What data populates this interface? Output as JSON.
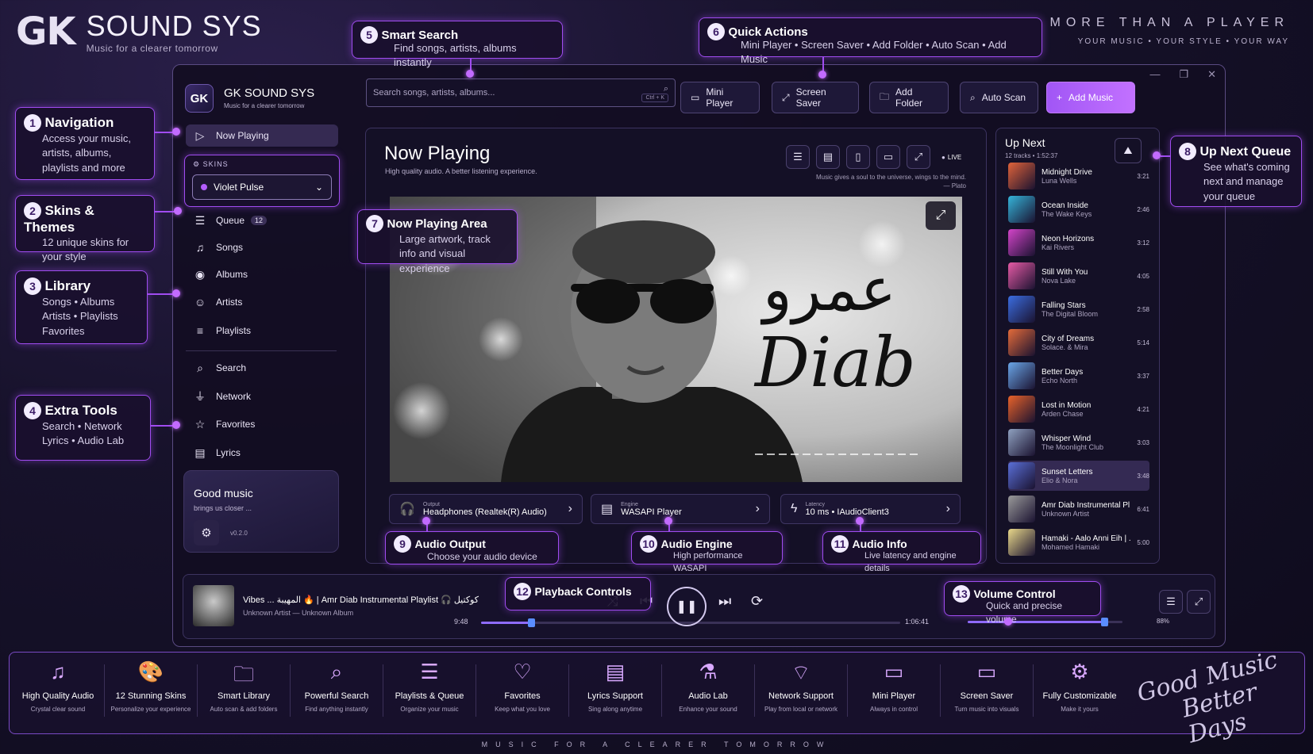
{
  "brand": {
    "logo": "GK",
    "name": "SOUND SYS",
    "tagline": "Music for a clearer tomorrow"
  },
  "header_right": {
    "title": "MORE THAN A PLAYER",
    "subtitle": "YOUR MUSIC  •  YOUR STYLE  •  YOUR WAY"
  },
  "window_controls": {
    "minimize": "—",
    "maximize": "❐",
    "close": "✕"
  },
  "callouts": [
    {
      "n": "1",
      "title": "Navigation",
      "sub": "Access your music, artists, albums, playlists and more"
    },
    {
      "n": "2",
      "title": "Skins & Themes",
      "sub": "12 unique skins for your style"
    },
    {
      "n": "3",
      "title": "Library",
      "sub": "Songs • Albums Artists • Playlists Favorites"
    },
    {
      "n": "4",
      "title": "Extra Tools",
      "sub": "Search • Network Lyrics • Audio Lab"
    },
    {
      "n": "5",
      "title": "Smart Search",
      "sub": "Find songs, artists, albums instantly"
    },
    {
      "n": "6",
      "title": "Quick Actions",
      "sub": "Mini Player • Screen Saver • Add Folder • Auto Scan • Add Music"
    },
    {
      "n": "7",
      "title": "Now Playing Area",
      "sub": "Large artwork, track info and visual experience"
    },
    {
      "n": "8",
      "title": "Up Next Queue",
      "sub": "See what's coming next and manage your queue"
    },
    {
      "n": "9",
      "title": "Audio Output",
      "sub": "Choose your audio device"
    },
    {
      "n": "10",
      "title": "Audio Engine",
      "sub": "High performance WASAPI"
    },
    {
      "n": "11",
      "title": "Audio Info",
      "sub": "Live latency and engine details"
    },
    {
      "n": "12",
      "title": "Playback Controls",
      "sub": ""
    },
    {
      "n": "13",
      "title": "Volume Control",
      "sub": "Quick and precise volume"
    }
  ],
  "sidebar": {
    "logo": "GK",
    "name": "GK SOUND SYS",
    "tagline": "Music for a clearer tomorrow",
    "now_playing": "Now Playing",
    "skins_label": "SKINS",
    "skin_selected": "Violet Pulse",
    "items": [
      {
        "label": "Queue",
        "badge": "12",
        "icon": "☰"
      },
      {
        "label": "Songs",
        "icon": "♫"
      },
      {
        "label": "Albums",
        "icon": "◉"
      },
      {
        "label": "Artists",
        "icon": "☺"
      },
      {
        "label": "Playlists",
        "icon": "≡"
      },
      {
        "label": "Search",
        "icon": "⌕"
      },
      {
        "label": "Network",
        "icon": "⏚"
      },
      {
        "label": "Favorites",
        "icon": "☆"
      },
      {
        "label": "Lyrics",
        "icon": "▤"
      }
    ],
    "card_title": "Good music",
    "card_sub": "brings us closer ...",
    "version": "v0.2.0"
  },
  "toolbar": {
    "search_placeholder": "Search songs, artists, albums...",
    "search_shortcut": "Ctrl + K",
    "mini_player": "Mini Player",
    "screen_saver": "Screen Saver",
    "add_folder": "Add Folder",
    "auto_scan": "Auto Scan",
    "add_music": "Add Music"
  },
  "now_playing": {
    "title": "Now Playing",
    "subtitle": "High quality audio. A better listening experience.",
    "quote": "Music gives a soul to the universe, wings to the mind.",
    "quote_author": "— Plato",
    "live": "LIVE",
    "art_text_arabic": "عمرو",
    "art_text_latin": "Diab"
  },
  "audio_info": {
    "output_label": "Output",
    "output_value": "Headphones (Realtek(R) Audio)",
    "engine_label": "Engine",
    "engine_value": "WASAPI Player",
    "latency_label": "Latency",
    "latency_value": "10 ms • IAudioClient3"
  },
  "up_next": {
    "title": "Up Next",
    "sub": "12 tracks • 1:52:37",
    "tracks": [
      {
        "song": "Midnight Drive",
        "artist": "Luna Wells",
        "dur": "3:21",
        "color": "#e0633a"
      },
      {
        "song": "Ocean Inside",
        "artist": "The Wake Keys",
        "dur": "2:46",
        "color": "#35b4d9"
      },
      {
        "song": "Neon Horizons",
        "artist": "Kai Rivers",
        "dur": "3:12",
        "color": "#d344c9"
      },
      {
        "song": "Still With You",
        "artist": "Nova Lake",
        "dur": "4:05",
        "color": "#e65aa5"
      },
      {
        "song": "Falling Stars",
        "artist": "The Digital Bloom",
        "dur": "2:58",
        "color": "#3b6de0"
      },
      {
        "song": "City of Dreams",
        "artist": "Solace. & Mira",
        "dur": "5:14",
        "color": "#e46b3a"
      },
      {
        "song": "Better Days",
        "artist": "Echo North",
        "dur": "3:37",
        "color": "#6aa6e8"
      },
      {
        "song": "Lost in Motion",
        "artist": "Arden Chase",
        "dur": "4:21",
        "color": "#e8622a"
      },
      {
        "song": "Whisper Wind",
        "artist": "The Moonlight Club",
        "dur": "3:03",
        "color": "#8fa1c0"
      },
      {
        "song": "Sunset Letters",
        "artist": "Elio & Nora",
        "dur": "3:48",
        "color": "#5a6fd8"
      },
      {
        "song": "Amr Diab Instrumental Pl... ♫",
        "artist": "Unknown Artist",
        "dur": "6:41",
        "color": "#9a9a9a"
      },
      {
        "song": "Hamaki - Aalo Anni Eih | ...",
        "artist": "Mohamed Hamaki",
        "dur": "5:00",
        "color": "#e9d88a"
      }
    ]
  },
  "player": {
    "track": "Vibes ... المهيبة 🔥 | Amr Diab Instrumental Playlist 🎧 كوكتيل",
    "artist": "Unknown Artist — Unknown Album",
    "elapsed": "9:48",
    "total": "1:06:41",
    "progress": 0.12,
    "volume": 0.88,
    "volume_label": "88%"
  },
  "features": [
    {
      "icon": "♫",
      "title": "High Quality Audio",
      "sub": "Crystal clear sound"
    },
    {
      "icon": "🎨",
      "title": "12 Stunning Skins",
      "sub": "Personalize your experience"
    },
    {
      "icon": "🗀",
      "title": "Smart Library",
      "sub": "Auto scan & add folders"
    },
    {
      "icon": "⌕",
      "title": "Powerful Search",
      "sub": "Find anything instantly"
    },
    {
      "icon": "☰",
      "title": "Playlists & Queue",
      "sub": "Organize your music"
    },
    {
      "icon": "♡",
      "title": "Favorites",
      "sub": "Keep what you love"
    },
    {
      "icon": "▤",
      "title": "Lyrics Support",
      "sub": "Sing along anytime"
    },
    {
      "icon": "⚗",
      "title": "Audio Lab",
      "sub": "Enhance your sound"
    },
    {
      "icon": "⌔",
      "title": "Network Support",
      "sub": "Play from local or network"
    },
    {
      "icon": "▭",
      "title": "Mini Player",
      "sub": "Always in control"
    },
    {
      "icon": "▭",
      "title": "Screen Saver",
      "sub": "Turn music into visuals"
    },
    {
      "icon": "⚙",
      "title": "Fully Customizable",
      "sub": "Make it yours"
    }
  ],
  "script_text_1": "Good Music",
  "script_text_2": "Better Days",
  "bottom_tagline": "MUSIC FOR A CLEARER TOMORROW"
}
